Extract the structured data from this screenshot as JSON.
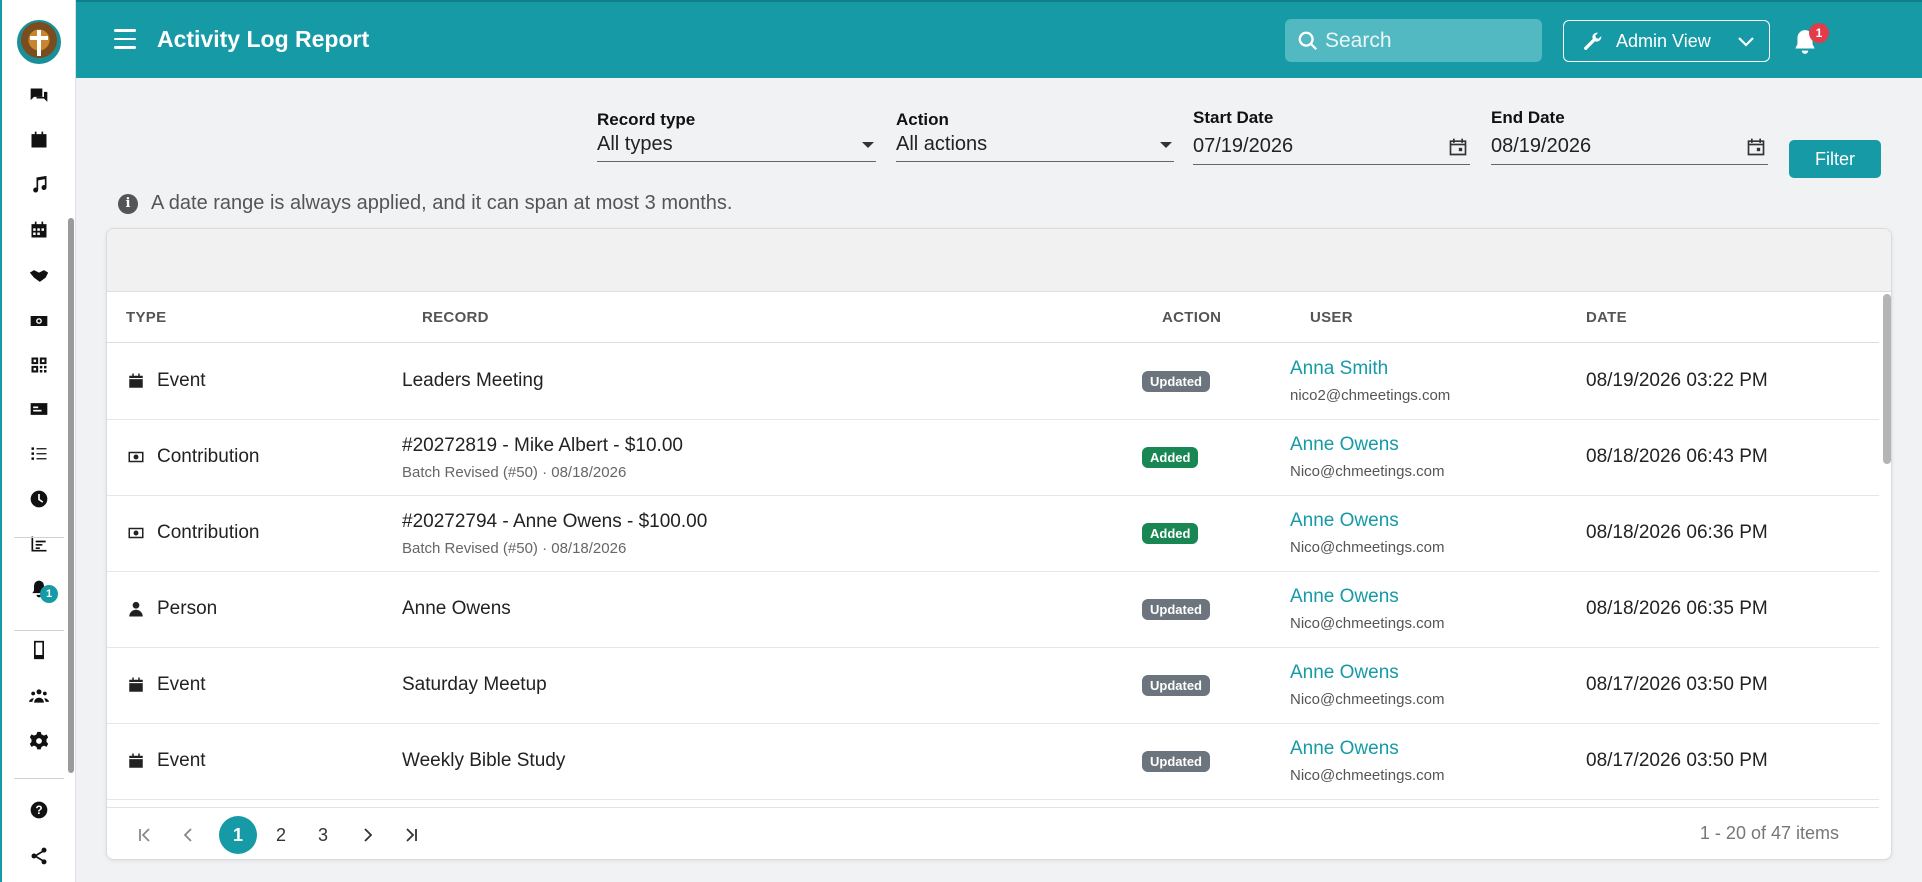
{
  "header": {
    "title": "Activity Log Report",
    "search_placeholder": "Search",
    "admin_label": "Admin View",
    "notification_count": "1",
    "help_label": "?"
  },
  "sidebar": {
    "notification_count": "1",
    "icons": [
      "chat-icon",
      "calendar-icon",
      "music-icon",
      "calendar-grid-icon",
      "handshake-icon",
      "money-icon",
      "qr-code-icon",
      "id-card-icon",
      "checklist-icon",
      "clock-icon",
      "report-icon",
      "bell-icon",
      "mobile-icon",
      "groups-icon",
      "gear-icon",
      "help-icon",
      "share-icon"
    ]
  },
  "filters": {
    "record_type": {
      "label": "Record type",
      "value": "All types"
    },
    "action": {
      "label": "Action",
      "value": "All actions"
    },
    "start_date": {
      "label": "Start Date",
      "value": "07/19/2026"
    },
    "end_date": {
      "label": "End Date",
      "value": "08/19/2026"
    },
    "filter_button": "Filter"
  },
  "note": "A date range is always applied, and it can span at most 3 months.",
  "table": {
    "columns": [
      "TYPE",
      "RECORD",
      "ACTION",
      "USER",
      "DATE"
    ],
    "rows": [
      {
        "type": "Event",
        "icon": "calendar-icon",
        "record": "Leaders Meeting",
        "sub": "",
        "action": "Updated",
        "user": "Anna Smith",
        "email": "nico2@chmeetings.com",
        "date": "08/19/2026 03:22 PM"
      },
      {
        "type": "Contribution",
        "icon": "money-icon",
        "record": "#20272819 - Mike Albert - $10.00",
        "sub": "Batch Revised (#50) · 08/18/2026",
        "action": "Added",
        "user": "Anne Owens",
        "email": "Nico@chmeetings.com",
        "date": "08/18/2026 06:43 PM"
      },
      {
        "type": "Contribution",
        "icon": "money-icon",
        "record": "#20272794 - Anne Owens - $100.00",
        "sub": "Batch Revised (#50) · 08/18/2026",
        "action": "Added",
        "user": "Anne Owens",
        "email": "Nico@chmeetings.com",
        "date": "08/18/2026 06:36 PM"
      },
      {
        "type": "Person",
        "icon": "person-icon",
        "record": "Anne Owens",
        "sub": "",
        "action": "Updated",
        "user": "Anne Owens",
        "email": "Nico@chmeetings.com",
        "date": "08/18/2026 06:35 PM"
      },
      {
        "type": "Event",
        "icon": "calendar-icon",
        "record": "Saturday Meetup",
        "sub": "",
        "action": "Updated",
        "user": "Anne Owens",
        "email": "Nico@chmeetings.com",
        "date": "08/17/2026 03:50 PM"
      },
      {
        "type": "Event",
        "icon": "calendar-icon",
        "record": "Weekly Bible Study",
        "sub": "",
        "action": "Updated",
        "user": "Anne Owens",
        "email": "Nico@chmeetings.com",
        "date": "08/17/2026 03:50 PM"
      }
    ]
  },
  "pager": {
    "pages": [
      "1",
      "2",
      "3"
    ],
    "current": "1",
    "info": "1 - 20 of 47 items"
  },
  "colors": {
    "accent": "#159aa6",
    "badge_updated": "#6c757d",
    "badge_added": "#198754",
    "notification": "#e23b4a"
  }
}
